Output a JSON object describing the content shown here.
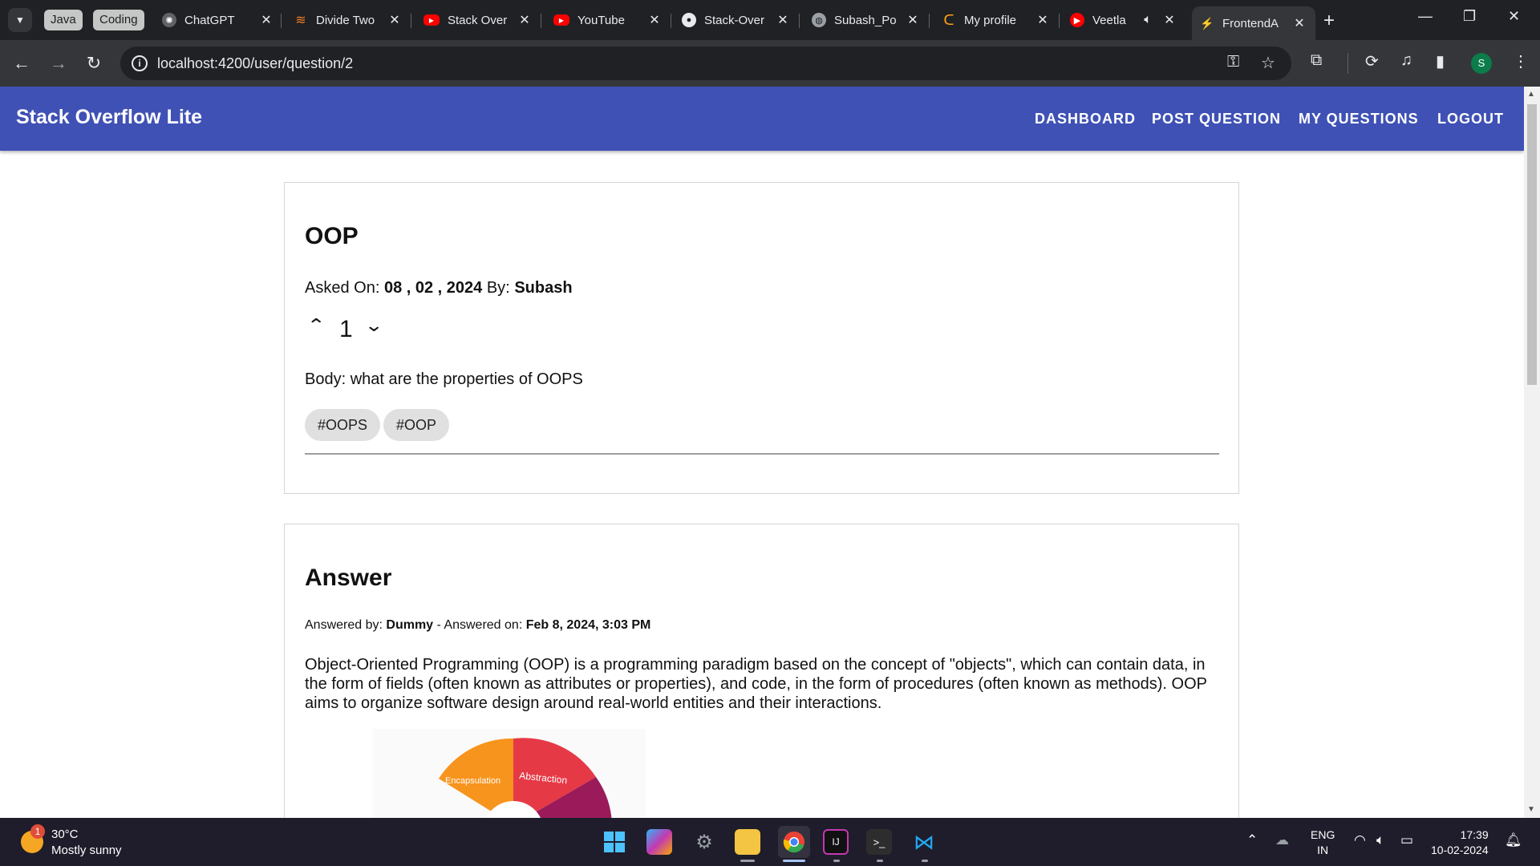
{
  "browser": {
    "tab_groups": [
      "Java",
      "Coding"
    ],
    "tabs": [
      {
        "title": "ChatGPT",
        "icon": "chatgpt-icon"
      },
      {
        "title": "Divide Two",
        "icon": "stackoverflow-icon"
      },
      {
        "title": "Stack Over",
        "icon": "youtube-icon"
      },
      {
        "title": "YouTube",
        "icon": "youtube-icon"
      },
      {
        "title": "Stack-Over",
        "icon": "github-icon"
      },
      {
        "title": "Subash_Po",
        "icon": "globe-icon"
      },
      {
        "title": "My profile",
        "icon": "leetcode-icon"
      },
      {
        "title": "Veetla",
        "icon": "youtube-music-icon"
      },
      {
        "title": "FrontendA",
        "icon": "angular-icon"
      }
    ],
    "url": "localhost:4200/user/question/2",
    "profile_initial": "S"
  },
  "app": {
    "brand": "Stack Overflow Lite",
    "nav": [
      "DASHBOARD",
      "POST QUESTION",
      "MY QUESTIONS",
      "LOGOUT"
    ]
  },
  "question": {
    "title": "OOP",
    "asked_on_label": "Asked On:",
    "asked_on": "08 , 02 , 2024",
    "by_label": "By:",
    "author": "Subash",
    "votes": "1",
    "body": "Body: what are the properties of OOPS",
    "tags": [
      "#OOPS",
      "#OOP"
    ]
  },
  "answer": {
    "heading": "Answer",
    "answered_by_label": "Answered by:",
    "answered_by": "Dummy",
    "answered_on_label": "- Answered on:",
    "answered_on": "Feb 8, 2024, 3:03 PM",
    "body": "Object-Oriented Programming (OOP) is a programming paradigm based on the concept of \"objects\", which can contain data, in the form of fields (often known as attributes or properties), and code, in the form of procedures (often known as methods). OOP aims to organize software design around real-world entities and their interactions.",
    "image_labels": [
      "Encapsulation",
      "Abstraction"
    ]
  },
  "taskbar": {
    "weather_badge": "1",
    "temperature": "30°C",
    "condition": "Mostly sunny",
    "lang_top": "ENG",
    "lang_bottom": "IN",
    "time": "17:39",
    "date": "10-02-2024"
  },
  "colors": {
    "appbar": "#3f51b5",
    "chip": "#e0e0e0",
    "chrome_dark": "#202124",
    "chrome_toolbar": "#35363a"
  }
}
